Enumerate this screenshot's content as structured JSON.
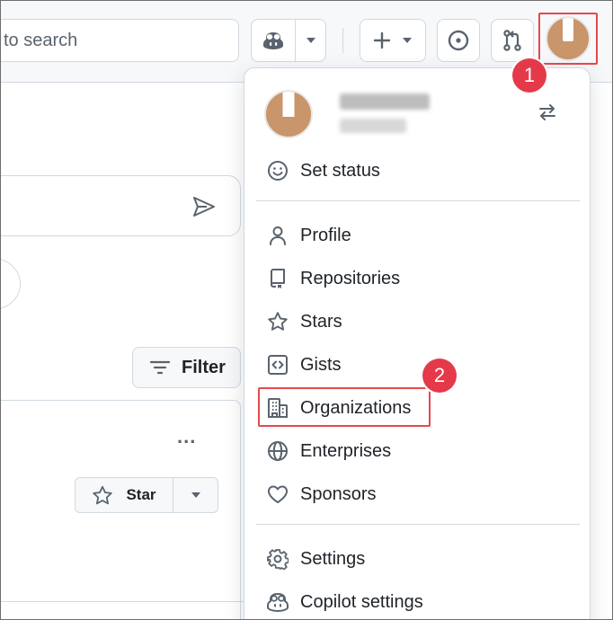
{
  "header": {
    "search_placeholder": "to search",
    "copilot_label": "Copilot",
    "create_label": "Create new",
    "issues_label": "Issues",
    "pulls_label": "Pull requests"
  },
  "page": {
    "filter_label": "Filter",
    "more_label": "...",
    "star_label": "Star"
  },
  "menu": {
    "set_status": "Set status",
    "items_group1": [
      {
        "label": "Profile",
        "icon": "person-icon"
      },
      {
        "label": "Repositories",
        "icon": "repo-icon"
      },
      {
        "label": "Stars",
        "icon": "star-icon"
      },
      {
        "label": "Gists",
        "icon": "code-square-icon"
      },
      {
        "label": "Organizations",
        "icon": "organization-icon"
      },
      {
        "label": "Enterprises",
        "icon": "globe-icon"
      },
      {
        "label": "Sponsors",
        "icon": "heart-icon"
      }
    ],
    "items_group2": [
      {
        "label": "Settings",
        "icon": "gear-icon"
      },
      {
        "label": "Copilot settings",
        "icon": "copilot-icon"
      }
    ]
  },
  "annotations": {
    "step1": "1",
    "step2": "2"
  },
  "colors": {
    "highlight": "#e5484d",
    "badge": "#e5394a",
    "avatar": "#c9956b"
  }
}
